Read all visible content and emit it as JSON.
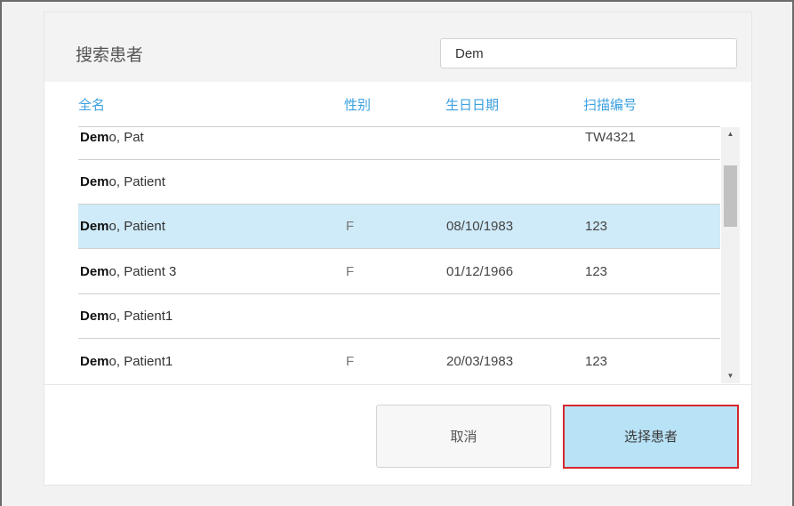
{
  "dialog": {
    "title": "搜索患者",
    "search": {
      "value": "Dem",
      "placeholder": ""
    }
  },
  "table": {
    "headers": {
      "name": "全名",
      "sex": "性别",
      "dob": "生日日期",
      "scan": "扫描编号"
    },
    "rows": [
      {
        "bold": "Dem",
        "rest": "o, Pat",
        "sex": "",
        "dob": "",
        "scan": "TW4321",
        "selected": false
      },
      {
        "bold": "Dem",
        "rest": "o, Patient",
        "sex": "",
        "dob": "",
        "scan": "",
        "selected": false
      },
      {
        "bold": "Dem",
        "rest": "o, Patient",
        "sex": "F",
        "dob": "08/10/1983",
        "scan": "123",
        "selected": true
      },
      {
        "bold": "Dem",
        "rest": "o, Patient 3",
        "sex": "F",
        "dob": "01/12/1966",
        "scan": "123",
        "selected": false
      },
      {
        "bold": "Dem",
        "rest": "o, Patient1",
        "sex": "",
        "dob": "",
        "scan": "",
        "selected": false
      },
      {
        "bold": "Dem",
        "rest": "o, Patient1",
        "sex": "F",
        "dob": "20/03/1983",
        "scan": "123",
        "selected": false
      }
    ]
  },
  "scrollbar": {
    "up_icon": "▲",
    "down_icon": "▼"
  },
  "footer": {
    "cancel_label": "取消",
    "select_label": "选择患者"
  },
  "colors": {
    "header_text": "#3ba0e0",
    "selected_row": "#cfeaf8",
    "primary_button": "#b8e2f6",
    "highlight_border": "#d6262c"
  }
}
